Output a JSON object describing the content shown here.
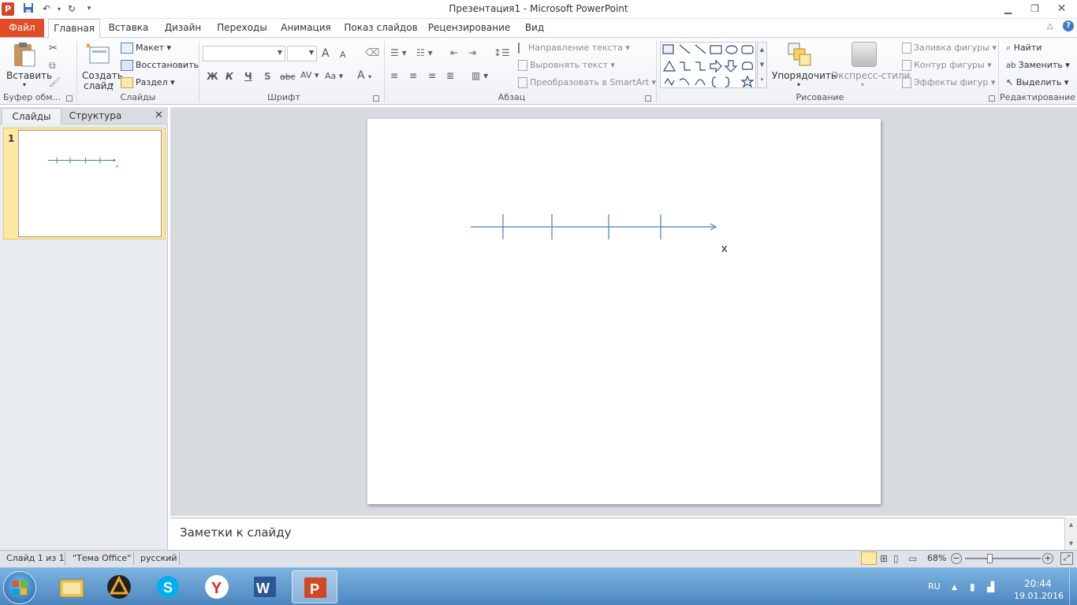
{
  "window": {
    "title": "Презентация1 - Microsoft PowerPoint",
    "app_icon_letter": "P",
    "controls": [
      "minimize-icon",
      "maximize-icon",
      "close-icon"
    ]
  },
  "tabs": {
    "file": "Файл",
    "items": [
      "Главная",
      "Вставка",
      "Дизайн",
      "Переходы",
      "Анимация",
      "Показ слайдов",
      "Рецензирование",
      "Вид"
    ],
    "active": "Главная"
  },
  "ribbon": {
    "clipboard": {
      "paste": "Вставить",
      "label": "Буфер обм..."
    },
    "slides": {
      "new_slide_line1": "Создать",
      "new_slide_line2": "слайд",
      "layout": "Макет",
      "reset": "Восстановить",
      "section": "Раздел",
      "label": "Слайды"
    },
    "font": {
      "bold": "Ж",
      "italic": "К",
      "underline": "Ч",
      "shadow": "S",
      "strike": "abc",
      "spacing": "AV",
      "case": "Aa",
      "color": "A",
      "grow": "A",
      "shrink": "A",
      "label": "Шрифт"
    },
    "paragraph": {
      "text_direction": "Направление текста",
      "align_text": "Выровнять текст",
      "smartart": "Преобразовать в SmartArt",
      "label": "Абзац"
    },
    "drawing": {
      "arrange": "Упорядочить",
      "quick_styles": "Экспресс-стили",
      "fill": "Заливка фигуры",
      "outline": "Контур фигуры",
      "effects": "Эффекты фигур",
      "label": "Рисование"
    },
    "editing": {
      "find": "Найти",
      "replace": "Заменить",
      "select": "Выделить",
      "label": "Редактирование"
    }
  },
  "left_pane": {
    "tab_slides": "Слайды",
    "tab_outline": "Структура",
    "slide_number": "1"
  },
  "slide": {
    "axis_label": "x"
  },
  "notes": {
    "placeholder": "Заметки к слайду"
  },
  "status": {
    "slide_info": "Слайд 1 из 1",
    "theme": "\"Тема Office\"",
    "language": "русский",
    "zoom": "68%",
    "zoom_fraction": 0.68
  },
  "taskbar": {
    "apps": [
      "explorer-icon",
      "aimp-icon",
      "skype-icon",
      "yandex-browser-icon",
      "word-icon",
      "powerpoint-icon"
    ],
    "active_app": "powerpoint-icon",
    "lang": "RU",
    "time": "20:44",
    "date": "19.01.2016"
  },
  "colors": {
    "file_tab": "#e34c26",
    "axis": "#4a7ebb",
    "thumb_highlight": "#fde8a4"
  }
}
